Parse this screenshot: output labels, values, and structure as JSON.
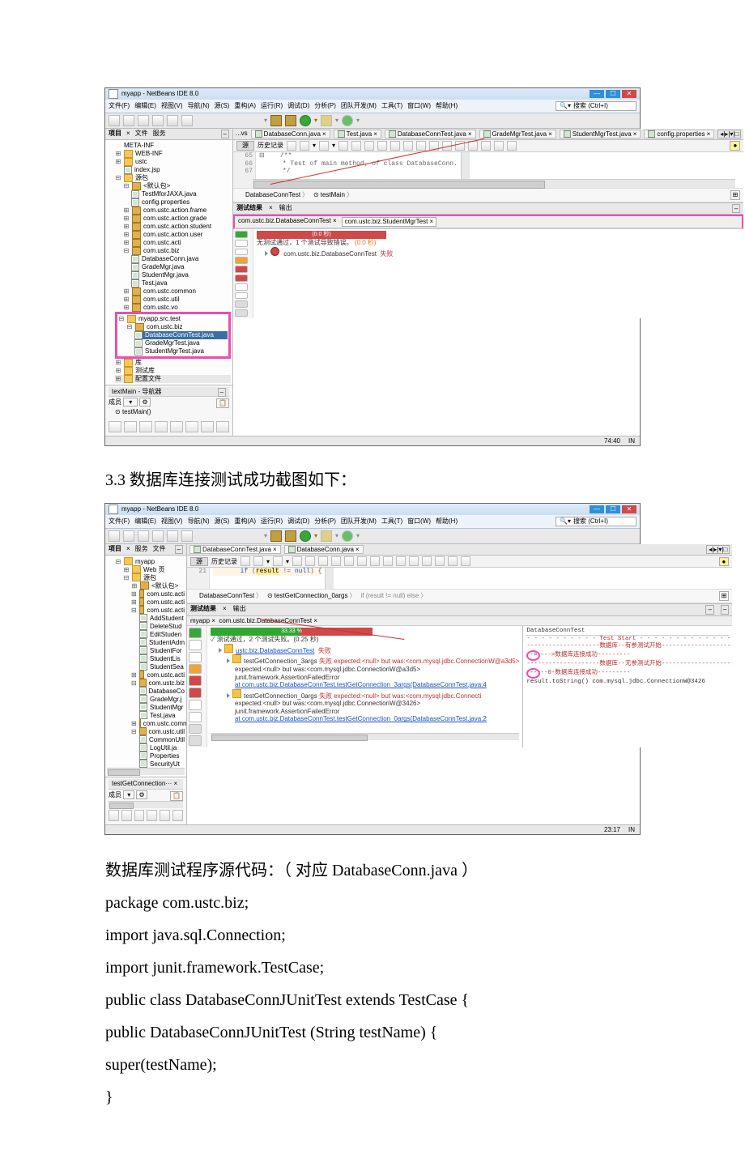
{
  "ide1": {
    "title": "myapp - NetBeans IDE 8.0",
    "menus": [
      "文件(F)",
      "编辑(E)",
      "视图(V)",
      "导航(N)",
      "源(S)",
      "重构(A)",
      "运行(R)",
      "调试(D)",
      "分析(P)",
      "团队开发(M)",
      "工具(T)",
      "窗口(W)",
      "帮助(H)"
    ],
    "search_placeholder": "搜索 (Ctrl+I)",
    "side_tabs": {
      "a": "项目",
      "b": "文件",
      "c": "服务"
    },
    "tree_top": "META-INF",
    "tree_items": [
      "WEB-INF",
      "ustc",
      "index.jsp"
    ],
    "pkg_root": "源包",
    "default_pkg": "<默认包>",
    "default_children": [
      "TestMforJAXA.java",
      "config.properties"
    ],
    "pkgs": [
      "com.ustc.action.frame",
      "com.ustc.action.grade",
      "com.ustc.action.student",
      "com.ustc.action.user",
      "com.ustc.acti",
      "com.ustc.biz"
    ],
    "biz_children": [
      "DatabaseConn.java",
      "GradeMgr.java",
      "StudentMgr.java",
      "Test.java"
    ],
    "pkgs_after": [
      "com.ustc.common",
      "com.ustc.util",
      "com.ustc.vo"
    ],
    "test_root": "myapp.src.test",
    "test_pkg": "com.ustc.biz",
    "test_children": [
      "DatabaseConnTest.java",
      "GradeMgrTest.java",
      "StudentMgrTest.java"
    ],
    "lib": "库",
    "test_lib": "测试库",
    "config_files": "配置文件",
    "nav_title": "textMain - 导航器",
    "nav_member": "成员",
    "nav_method": "testMain()",
    "editor_tabs": [
      "...vs",
      "DatabaseConn.java",
      "Test.java",
      "DatabaseConnTest.java",
      "GradeMgrTest.java",
      "StudentMgrTest.java",
      "config.properties"
    ],
    "sub_toolbar_left": "源",
    "sub_toolbar_hist": "历史记录",
    "gutter": [
      "65",
      "66",
      "67"
    ],
    "code_line1": "/**",
    "code_line2": " * Test of main method, of class DatabaseConn.",
    "code_line3": " */",
    "crumb_1": "DatabaseConnTest",
    "crumb_2": "testMain",
    "out_tab1": "测试结果",
    "out_tab2": "输出",
    "out_header": "com.ustc.biz.DatabaseConnTest ×",
    "out_header_ext": "com.ustc.biz.StudentMgrTest ×",
    "out_pass": "无测试通过，1 个测试导致错误。",
    "out_pass_time": "(0.0 秒)",
    "out_line": "com.ustc.biz.DatabaseConnTest",
    "out_line_fail": "失败",
    "status_pos": "74:40"
  },
  "heading1": "3.3 数据库连接测试成功截图如下：",
  "ide2": {
    "title": "myapp - NetBeans IDE 8.0",
    "menus": [
      "文件(F)",
      "编辑(E)",
      "视图(V)",
      "导航(N)",
      "源(S)",
      "重构(A)",
      "运行(R)",
      "调试(D)",
      "分析(P)",
      "团队开发(M)",
      "工具(T)",
      "窗口(W)",
      "帮助(H)"
    ],
    "search_placeholder": "搜索 (Ctrl+I)",
    "side_tabs": {
      "a": "项目",
      "b": "服务",
      "c": "文件"
    },
    "tree_root": "myapp",
    "tree_l1": [
      "Web 页",
      "源包"
    ],
    "default_pkg": "<默认包>",
    "pkgs_pre": [
      "com.ustc.acti",
      "com.ustc.acti",
      "com.ustc.acti",
      "com.ustc.acti"
    ],
    "acti_children": [
      "AddStudent",
      "DeleteStud",
      "EditStuden",
      "StudentAdm",
      "StudentFor",
      "StudentLis",
      "StudentSea"
    ],
    "pkg_acti2": "com.ustc.acti",
    "pkg_biz": "com.ustc.biz",
    "biz_children": [
      "DatabaseCo",
      "GradeMgr.j",
      "StudentMgr",
      "Test.java"
    ],
    "pkg_common": "com.ustc.comm",
    "pkg_util": "com.ustc.util",
    "util_children": [
      "CommonUtil",
      "LogUtil.ja",
      "Properties",
      "SecurityUt"
    ],
    "nav_title": "testGetConnection···",
    "nav_member": "成员",
    "editor_tab": "DatabaseConnTest.java",
    "editor_tab2": "DatabaseConn.java",
    "sub_toolbar_left": "源",
    "sub_toolbar_hist": "历史记录",
    "gutter_line": "21",
    "code_hl": "if (result != null) {",
    "crumb_1": "DatabaseConnTest",
    "crumb_2": "testGetConnection_0args",
    "crumb_suffix": "if (result != null) else",
    "out_tab1": "测试结果",
    "out_tab2": "输出",
    "out_header": "myapp ×",
    "out_header2": "com.ustc.biz.DatabaseConnTest ×",
    "prog_text": "33.33 %",
    "a": "测试通过，2 个测试失败。(0.25 秒)",
    "b_root": "ustc.biz.DatabaseConnTest",
    "b_fail": "失败",
    "c_line1": "testGetConnection_3args",
    "c_fail": "失败",
    "c_exp": "expected:<null> but was:<com.mysql.jdbc.ConnectionW@a3d5>",
    "d1": "expected:<null> but was:<com.mysql.jdbc.ConnectionW@a3d5>",
    "d2": "junit.framework.AssertionFailedError",
    "d3": "at com.ustc.biz.DatabaseConnTest.testGetConnection_3args(DatabaseConnTest.java:4",
    "e_line1": "testGetConnection_0args",
    "e_fail": "失败",
    "e_exp": "expected:<null> but was:<com.mysql.jdbc.Connecti",
    "f1": "expected:<null> but was:<com.mysql.jdbc.ConnectionW@3426>",
    "f2": "junit.framework.AssertionFailedError",
    "f3": "at com.ustc.biz.DatabaseConnTest.testGetConnection_0args(DatabaseConnTest.java:2",
    "console_title": "DatabaseConnTest",
    "console_l1": "- - - - - - - - - - Test Start - - - - - - - - - - - - -",
    "console_l2": "--------------------数据库--有参测试开始----------------------",
    "console_l3": "--->数据库连接成功---------",
    "console_l4": "--------------------数据库--无参测试开始----------------------",
    "console_l5": "--0-数据库连接成功---------",
    "console_l6": "result.toString() com.mysql.jdbc.ConnectionW@3426",
    "status_pos": "23:17"
  },
  "body_text": {
    "l1": "数据库测试程序源代码：（ 对应 DatabaseConn.java ）",
    "l2": "package com.ustc.biz;",
    "l3": "import java.sql.Connection;",
    "l4": "import junit.framework.TestCase;",
    "l5": "public class DatabaseConnJUnitTest extends TestCase {",
    "l6": " public DatabaseConnJUnitTest (String testName) {",
    "l7": " super(testName);",
    "l8": " }"
  }
}
